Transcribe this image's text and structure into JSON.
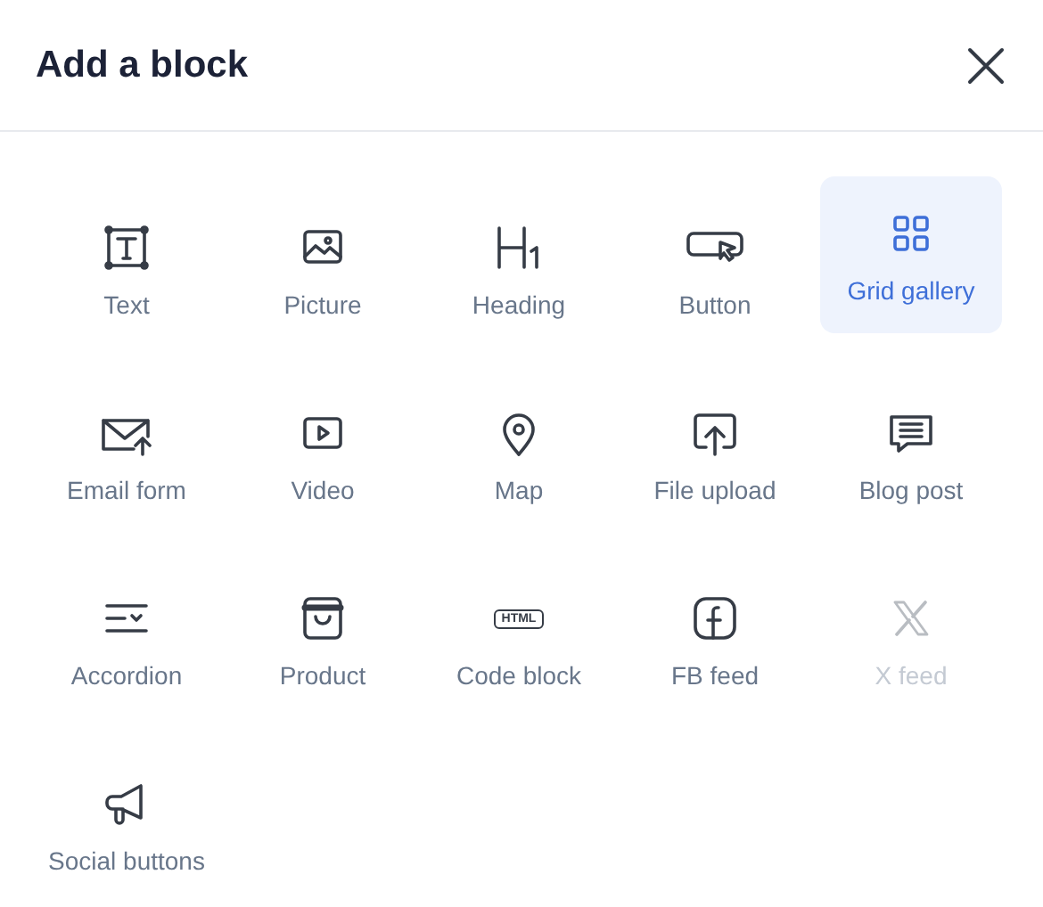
{
  "dialog": {
    "title": "Add a block"
  },
  "blocks": [
    {
      "kind": "text",
      "label": "Text",
      "selected": false,
      "disabled": false
    },
    {
      "kind": "picture",
      "label": "Picture",
      "selected": false,
      "disabled": false
    },
    {
      "kind": "heading",
      "label": "Heading",
      "selected": false,
      "disabled": false
    },
    {
      "kind": "button",
      "label": "Button",
      "selected": false,
      "disabled": false
    },
    {
      "kind": "grid",
      "label": "Grid gallery",
      "selected": true,
      "disabled": false
    },
    {
      "kind": "email",
      "label": "Email form",
      "selected": false,
      "disabled": false
    },
    {
      "kind": "video",
      "label": "Video",
      "selected": false,
      "disabled": false
    },
    {
      "kind": "map",
      "label": "Map",
      "selected": false,
      "disabled": false
    },
    {
      "kind": "upload",
      "label": "File upload",
      "selected": false,
      "disabled": false
    },
    {
      "kind": "blog",
      "label": "Blog post",
      "selected": false,
      "disabled": false
    },
    {
      "kind": "accordion",
      "label": "Accordion",
      "selected": false,
      "disabled": false
    },
    {
      "kind": "product",
      "label": "Product",
      "selected": false,
      "disabled": false
    },
    {
      "kind": "code",
      "label": "Code block",
      "badge": "HTML",
      "selected": false,
      "disabled": false
    },
    {
      "kind": "facebook",
      "label": "FB feed",
      "selected": false,
      "disabled": false
    },
    {
      "kind": "x",
      "label": "X feed",
      "selected": false,
      "disabled": true
    },
    {
      "kind": "social",
      "label": "Social buttons",
      "selected": false,
      "disabled": false
    }
  ]
}
